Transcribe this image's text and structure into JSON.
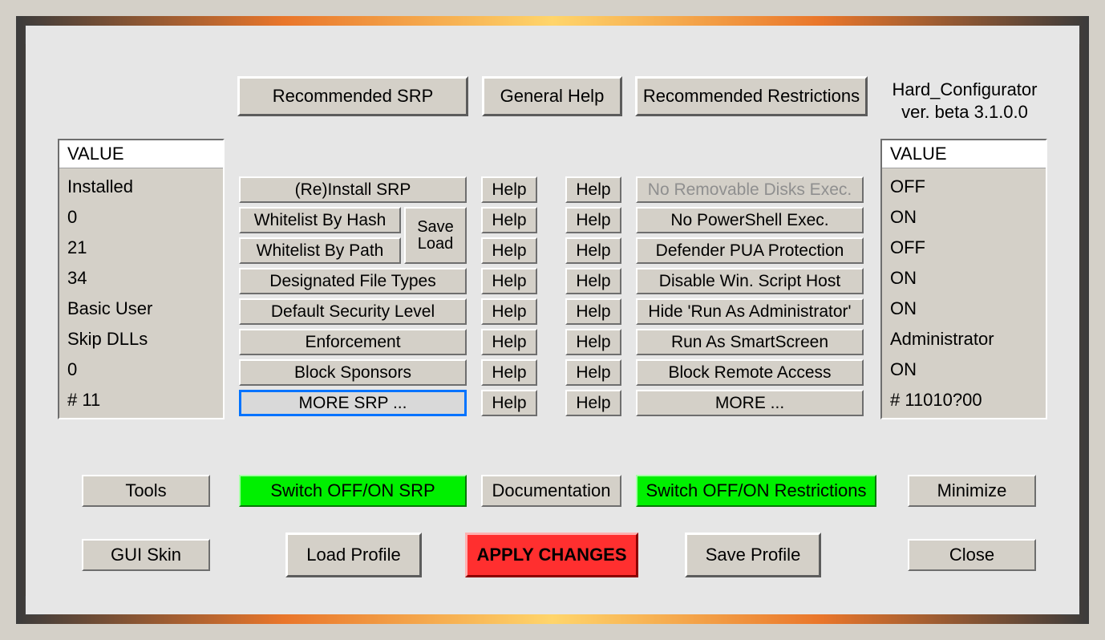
{
  "version": {
    "name": "Hard_Configurator",
    "ver": "ver. beta 3.1.0.0"
  },
  "top_buttons": {
    "recommended_srp": "Recommended SRP",
    "general_help": "General Help",
    "recommended_restrictions": "Recommended Restrictions"
  },
  "left_values": {
    "header": "VALUE",
    "items": [
      "Installed",
      "0",
      "21",
      "34",
      "Basic User",
      "Skip DLLs",
      "0",
      "# 11"
    ]
  },
  "right_values": {
    "header": "VALUE",
    "items": [
      "OFF",
      "ON",
      "OFF",
      "ON",
      "ON",
      "Administrator",
      "ON",
      "# 11010?00"
    ]
  },
  "srp_column": {
    "reinstall": "(Re)Install SRP",
    "whitelist_hash": "Whitelist By Hash",
    "whitelist_path": "Whitelist By Path",
    "save_load": "Save Load",
    "designated": "Designated File Types",
    "default_level": "Default Security Level",
    "enforcement": "Enforcement",
    "block_sponsors": "Block Sponsors",
    "more": "MORE SRP ..."
  },
  "restrictions_column": {
    "no_removable": "No Removable Disks Exec.",
    "no_powershell": "No PowerShell Exec.",
    "defender_pua": "Defender PUA Protection",
    "disable_wsh": "Disable Win. Script Host",
    "hide_runas": "Hide  'Run As Administrator'",
    "run_smartscreen": "Run As SmartScreen",
    "block_remote": "Block Remote Access",
    "more": "MORE ..."
  },
  "help_label": "Help",
  "bottom_row1": {
    "tools": "Tools",
    "switch_srp": "Switch OFF/ON SRP",
    "documentation": "Documentation",
    "switch_restrictions": "Switch OFF/ON Restrictions",
    "minimize": "Minimize"
  },
  "bottom_row2": {
    "gui_skin": "GUI Skin",
    "load_profile": "Load Profile",
    "apply": "APPLY CHANGES",
    "save_profile": "Save Profile",
    "close": "Close"
  }
}
